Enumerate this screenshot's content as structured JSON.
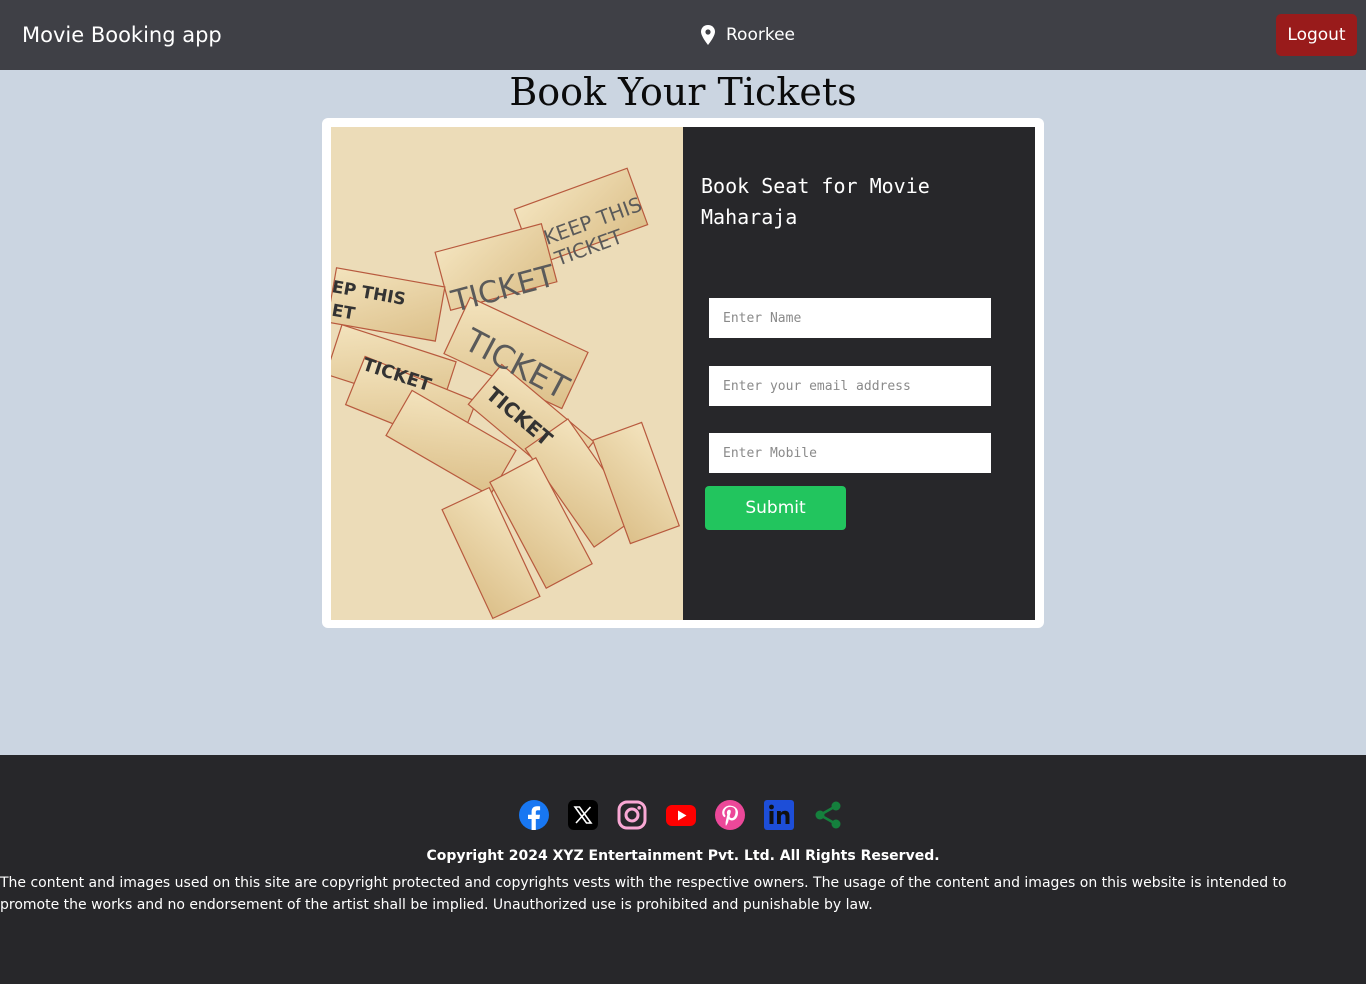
{
  "navbar": {
    "brand": "Movie Booking app",
    "location": "Roorkee",
    "logout_label": "Logout"
  },
  "page_title": "Book Your Tickets",
  "booking_form": {
    "title_line1": "Book Seat for Movie",
    "title_line2": "Maharaja",
    "name_placeholder": "Enter Name",
    "email_placeholder": "Enter your email address",
    "mobile_placeholder": "Enter Mobile",
    "submit_label": "Submit"
  },
  "image_text": {
    "ticket": "TICKET",
    "keep_this": "KEEP THIS",
    "keep_ticket": "TICKET",
    "keep_this_left": "EP THIS",
    "ticket_left": "ET"
  },
  "footer": {
    "social_icons": [
      "facebook-icon",
      "x-icon",
      "instagram-icon",
      "youtube-icon",
      "pinterest-icon",
      "linkedin-icon",
      "share-icon"
    ],
    "copyright": "Copyright 2024 XYZ Entertainment Pvt. Ltd. All Rights Reserved.",
    "disclaimer": "The content and images used on this site are copyright protected and copyrights vests with the respective owners. The usage of the content and images on this website is intended to promote the works and no endorsement of the artist shall be implied. Unauthorized use is prohibited and punishable by law."
  },
  "colors": {
    "navbar": "#3f4046",
    "page_background": "#cbd5e1",
    "logout": "#991b1b",
    "submit": "#22c55e",
    "form_panel": "#27272a",
    "footer": "#27272a"
  }
}
